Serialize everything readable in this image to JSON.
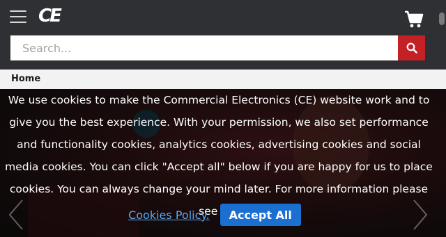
{
  "header": {
    "logo_text": "CE",
    "search": {
      "placeholder": "Search..."
    }
  },
  "breadcrumb": {
    "home": "Home"
  },
  "cookie_banner": {
    "message": "We use cookies to make the Commercial Electronics (CE) website work and to give you the best experience. With your permission, we also set performance and functionality cookies, analytics cookies, advertising cookies and social media cookies. You can click \"Accept all\" below if you are happy for us to place cookies. You can always change your mind later. For more information please see our",
    "policy_link": "Cookies Policy.",
    "accept_label": "Accept All"
  },
  "colors": {
    "header_bg": "#2f3033",
    "search_button": "#c42127",
    "accept_button": "#1a6fd1",
    "link": "#5aa9f5"
  },
  "icons": [
    "menu-icon",
    "cart-icon",
    "search-icon",
    "chevron-left-icon",
    "chevron-right-icon"
  ]
}
